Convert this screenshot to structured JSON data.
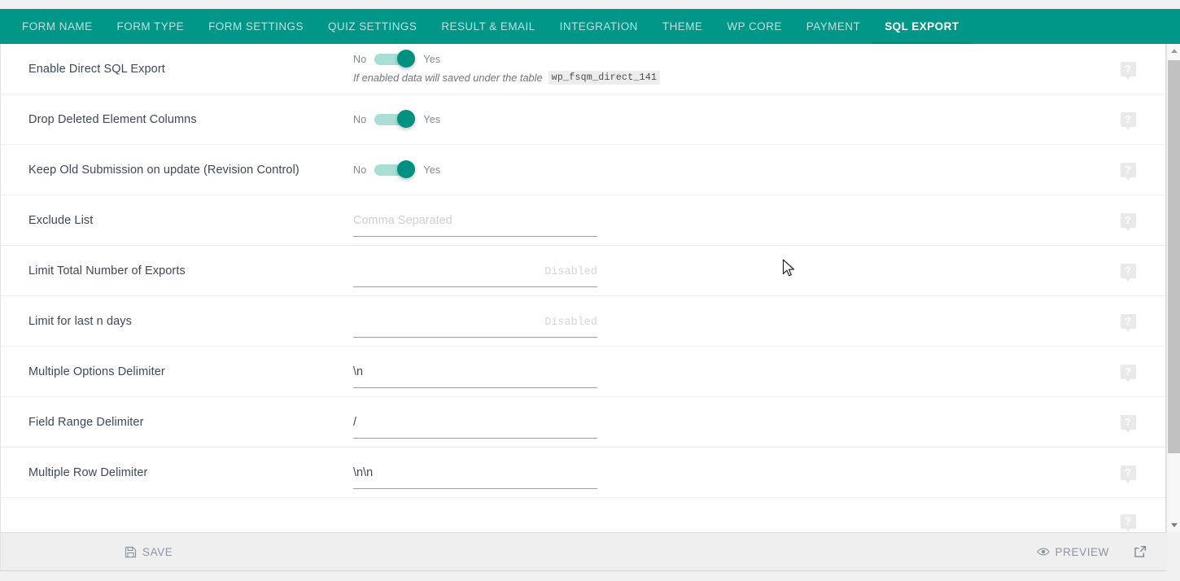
{
  "tabs": [
    {
      "label": "FORM NAME",
      "active": false
    },
    {
      "label": "FORM TYPE",
      "active": false
    },
    {
      "label": "FORM SETTINGS",
      "active": false
    },
    {
      "label": "QUIZ SETTINGS",
      "active": false
    },
    {
      "label": "RESULT & EMAIL",
      "active": false
    },
    {
      "label": "INTEGRATION",
      "active": false
    },
    {
      "label": "THEME",
      "active": false
    },
    {
      "label": "WP CORE",
      "active": false
    },
    {
      "label": "PAYMENT",
      "active": false
    },
    {
      "label": "SQL EXPORT",
      "active": true
    }
  ],
  "colors": {
    "header_teal": "#009688",
    "active_tab_underline": "#00897b",
    "switch_track": "#a9ded5",
    "switch_knob": "#009181",
    "label_text": "#3c4858",
    "muted_text": "#8b949e",
    "footer_bg": "#efefef"
  },
  "settings": {
    "rows": [
      {
        "label": "Enable Direct SQL Export",
        "control": "switch",
        "off_label": "No",
        "on_label": "Yes",
        "value": "Yes",
        "hint_text": "If enabled data will saved under the table",
        "hint_code": "wp_fsqm_direct_141",
        "help": "?"
      },
      {
        "label": "Drop Deleted Element Columns",
        "control": "switch",
        "off_label": "No",
        "on_label": "Yes",
        "value": "Yes",
        "help": "?"
      },
      {
        "label": "Keep Old Submission on update (Revision Control)",
        "control": "switch",
        "off_label": "No",
        "on_label": "Yes",
        "value": "Yes",
        "help": "?"
      },
      {
        "label": "Exclude List",
        "control": "text",
        "value": "",
        "placeholder": "Comma Separated",
        "align": "left",
        "help": "?"
      },
      {
        "label": "Limit Total Number of Exports",
        "control": "number",
        "value": "",
        "placeholder": "Disabled",
        "align": "right",
        "help": "?"
      },
      {
        "label": "Limit for last n days",
        "control": "number",
        "value": "",
        "placeholder": "Disabled",
        "align": "right",
        "help": "?"
      },
      {
        "label": "Multiple Options Delimiter",
        "control": "text",
        "value": "\\n",
        "placeholder": "",
        "align": "left",
        "help": "?"
      },
      {
        "label": "Field Range Delimiter",
        "control": "text",
        "value": "/",
        "placeholder": "",
        "align": "left",
        "help": "?"
      },
      {
        "label": "Multiple Row Delimiter",
        "control": "text",
        "value": "\\n\\n",
        "placeholder": "",
        "align": "left",
        "help": "?"
      }
    ]
  },
  "footer": {
    "save_label": "SAVE",
    "preview_label": "PREVIEW",
    "save_icon": "floppy-disk-icon",
    "preview_icon": "eye-icon",
    "external_icon": "external-link-icon"
  },
  "scrollbar": {
    "up_arrow": "chevron-up-icon",
    "down_arrow": "chevron-down-icon"
  }
}
